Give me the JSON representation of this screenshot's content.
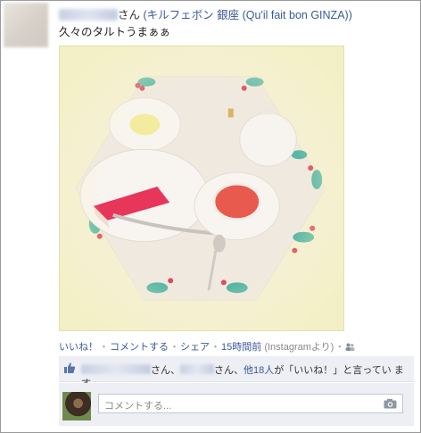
{
  "post": {
    "suffix": "さん",
    "location": "(キルフェボン 銀座 (Qu'il fait bon GINZA))",
    "text": "久々のタルトうまぁぁ"
  },
  "actions": {
    "like": "いいね！",
    "dot1": "・",
    "comment": "コメントする",
    "dot2": "・",
    "share": "シェア",
    "dot3": "・",
    "time": "15時間前",
    "via": "(Instagramより)",
    "dot4": "・"
  },
  "likes": {
    "mid1": "さん、",
    "mid2": "さん、",
    "others": "他18人",
    "tail": "が「いいね！」と言ってい ま",
    "tail2": "す。"
  },
  "comment": {
    "placeholder": "コメントする..."
  },
  "icons": {
    "like": "thumbs-up-icon",
    "camera": "camera-icon",
    "audience": "friends-icon"
  },
  "colors": {
    "link": "#3b5998",
    "panel": "#edeff4"
  }
}
